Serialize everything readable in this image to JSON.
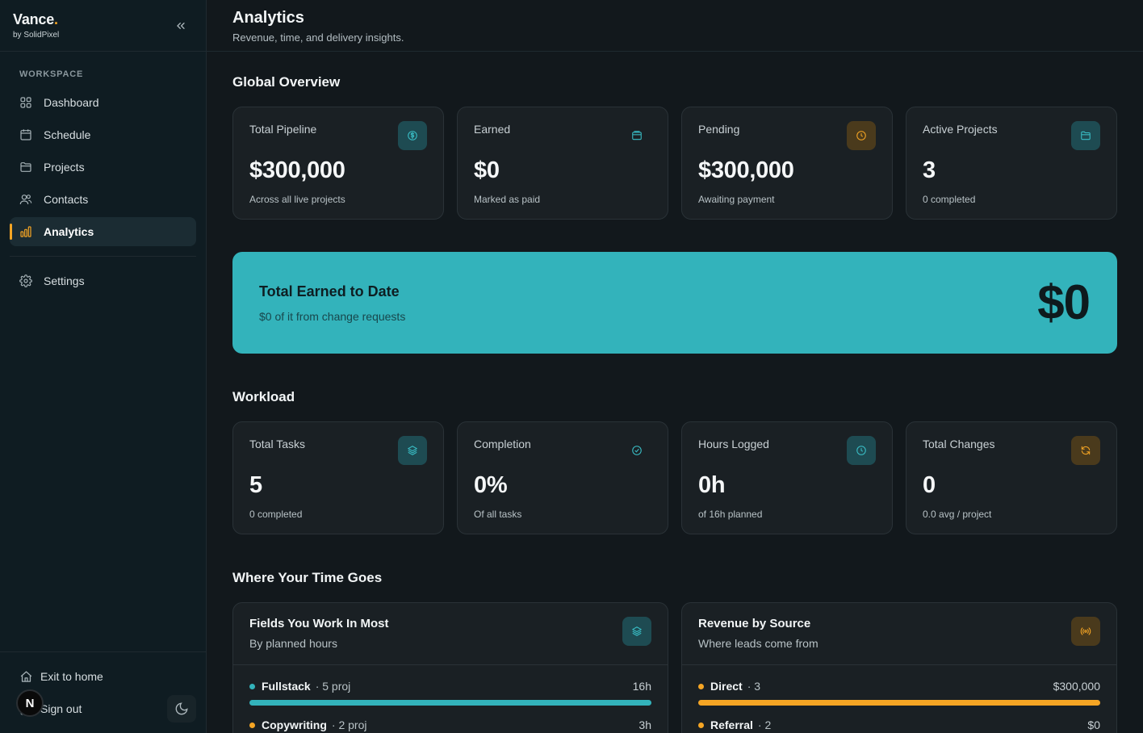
{
  "brand": {
    "name": "Vance",
    "dot": ".",
    "by": "by SolidPixel"
  },
  "sidebar": {
    "section_label": "WORKSPACE",
    "items": [
      {
        "label": "Dashboard",
        "icon": "grid-icon"
      },
      {
        "label": "Schedule",
        "icon": "calendar-icon"
      },
      {
        "label": "Projects",
        "icon": "folder-icon"
      },
      {
        "label": "Contacts",
        "icon": "users-icon"
      },
      {
        "label": "Analytics",
        "icon": "bar-chart-icon",
        "active": true
      },
      {
        "label": "Settings",
        "icon": "gear-icon"
      }
    ],
    "exit_label": "Exit to home",
    "signout_label": "Sign out",
    "avatar_initial": "N"
  },
  "header": {
    "title": "Analytics",
    "subtitle": "Revenue, time, and delivery insights."
  },
  "global_overview": {
    "title": "Global Overview",
    "cards": [
      {
        "label": "Total Pipeline",
        "value": "$300,000",
        "sub": "Across all live projects",
        "icon": "dollar-circle-icon",
        "tint": "teal"
      },
      {
        "label": "Earned",
        "value": "$0",
        "sub": "Marked as paid",
        "icon": "wallet-icon",
        "tint": "none"
      },
      {
        "label": "Pending",
        "value": "$300,000",
        "sub": "Awaiting payment",
        "icon": "clock-icon",
        "tint": "amber"
      },
      {
        "label": "Active Projects",
        "value": "3",
        "sub": "0 completed",
        "icon": "folder-icon",
        "tint": "teal"
      }
    ]
  },
  "banner": {
    "title": "Total Earned to Date",
    "sub": "$0 of it from change requests",
    "value": "$0"
  },
  "workload": {
    "title": "Workload",
    "cards": [
      {
        "label": "Total Tasks",
        "value": "5",
        "sub": "0 completed",
        "icon": "layers-icon",
        "tint": "teal"
      },
      {
        "label": "Completion",
        "value": "0%",
        "sub": "Of all tasks",
        "icon": "check-circle-icon",
        "tint": "none"
      },
      {
        "label": "Hours Logged",
        "value": "0h",
        "sub": "of 16h planned",
        "icon": "clock-icon",
        "tint": "teal"
      },
      {
        "label": "Total Changes",
        "value": "0",
        "sub": "0.0 avg / project",
        "icon": "refresh-icon",
        "tint": "amber"
      }
    ]
  },
  "time_goes": {
    "title": "Where Your Time Goes",
    "fields": {
      "title": "Fields You Work In Most",
      "sub": "By planned hours",
      "rows": [
        {
          "name": "Fullstack",
          "meta": "· 5 proj",
          "value": "16h",
          "fraction": 1.0,
          "color": "#33b3bb"
        },
        {
          "name": "Copywriting",
          "meta": "· 2 proj",
          "value": "3h",
          "fraction": 0.19,
          "color": "#f5a524"
        }
      ]
    },
    "revenue": {
      "title": "Revenue by Source",
      "sub": "Where leads come from",
      "rows": [
        {
          "name": "Direct",
          "meta": "· 3",
          "value": "$300,000",
          "fraction": 1.0,
          "color": "#f5a524"
        },
        {
          "name": "Referral",
          "meta": "· 2",
          "value": "$0",
          "fraction": 0.0,
          "color": "#f5a524"
        }
      ]
    }
  },
  "colors": {
    "accent_teal": "#33b3bb",
    "accent_amber": "#f5a524"
  }
}
